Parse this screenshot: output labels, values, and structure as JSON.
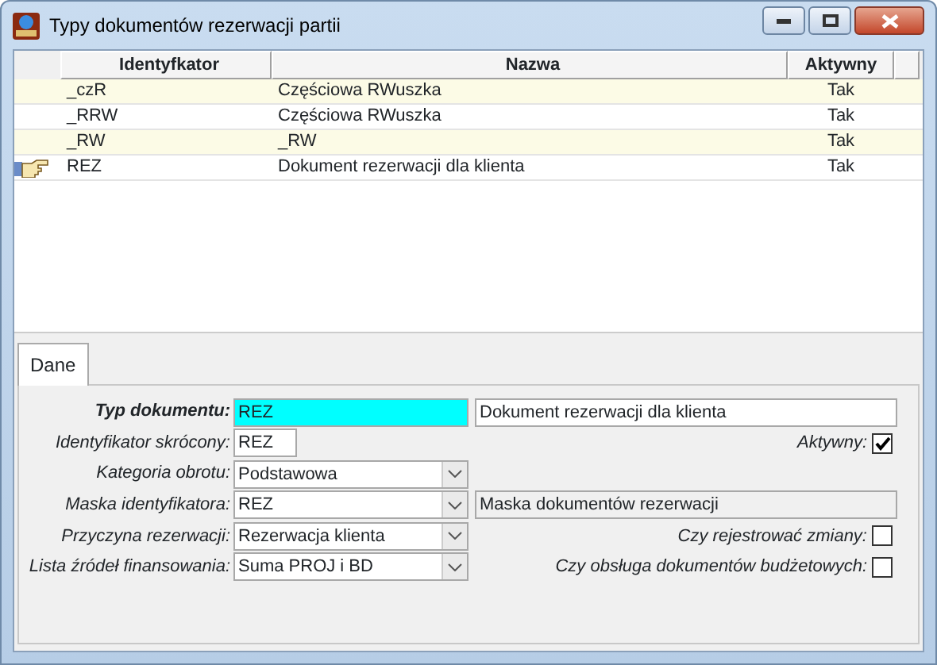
{
  "window": {
    "title": "Typy dokumentów rezerwacji partii"
  },
  "table": {
    "columns": [
      "Identyfkator",
      "Nazwa",
      "Aktywny"
    ],
    "rows": [
      {
        "cells": [
          "_czR",
          "Częściowa RWuszka",
          "Tak"
        ],
        "selected": false
      },
      {
        "cells": [
          "_RRW",
          "Częściowa RWuszka",
          "Tak"
        ],
        "selected": false
      },
      {
        "cells": [
          "_RW",
          "_RW",
          "Tak"
        ],
        "selected": false
      },
      {
        "cells": [
          "REZ",
          "Dokument rezerwacji dla klienta",
          "Tak"
        ],
        "selected": true
      }
    ]
  },
  "tabs": [
    {
      "label": "Dane",
      "selected": true
    }
  ],
  "form": [
    {
      "label": "Typ dokumentu:",
      "bold": true,
      "field": {
        "kind": "text",
        "value": "REZ",
        "focused": true
      },
      "extra": {
        "value": "Dokument rezerwacji dla klienta",
        "readonly": false
      }
    },
    {
      "label": "Identyfikator skrócony:",
      "bold": false,
      "field": {
        "kind": "text",
        "value": "REZ",
        "focused": false
      },
      "check": {
        "label": "Aktywny:",
        "checked": true
      }
    },
    {
      "label": "Kategoria obrotu:",
      "bold": false,
      "field": {
        "kind": "combo",
        "value": "Podstawowa"
      }
    },
    {
      "label": "Maska identyfikatora:",
      "bold": false,
      "field": {
        "kind": "combo",
        "value": "REZ"
      },
      "extra": {
        "value": "Maska dokumentów rezerwacji",
        "readonly": true
      }
    },
    {
      "label": "Przyczyna rezerwacji:",
      "bold": false,
      "field": {
        "kind": "combo",
        "value": "Rezerwacja klienta"
      },
      "check": {
        "label": "Czy rejestrować zmiany:",
        "checked": false
      }
    },
    {
      "label": "Lista źródeł finansowania:",
      "bold": false,
      "field": {
        "kind": "combo",
        "value": "Suma PROJ i BD"
      },
      "check": {
        "label": "Czy obsługa dokumentów budżetowych:",
        "checked": false
      }
    }
  ]
}
